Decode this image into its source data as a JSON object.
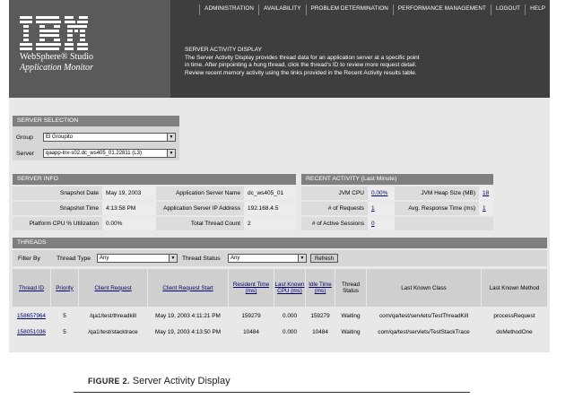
{
  "nav": [
    "ADMINISTRATION",
    "AVAILABILITY",
    "PROBLEM DETERMINATION",
    "PERFORMANCE MANAGEMENT",
    "LOGOUT",
    "HELP"
  ],
  "brand": {
    "logo": "IBM",
    "line1": "WebSphere® Studio",
    "line2": "Application Monitor"
  },
  "intro": {
    "title": "SERVER ACTIVITY DISPLAY",
    "line1": "The Server Activity Display provides thread data for an application server at a specific point",
    "line2": "in time. After pinpointing a hung thread, click the thread's ID to review more request detail.",
    "line3": "Review recent memory activity using the links provided in the Recent Activity results table."
  },
  "server_selection": {
    "title": "SERVER SELECTION",
    "group_label": "Group",
    "group_value": "El Groupito",
    "server_label": "Server",
    "server_value": "qaapp-lnx-s02.dc_ws405_01.22811 (L3)"
  },
  "server_info": {
    "title": "SERVER INFO",
    "snapshot_date_label": "Snapshot Date",
    "snapshot_date": "May 19, 2003",
    "app_server_name_label": "Application Server Name",
    "app_server_name": "dc_ws405_01",
    "snapshot_time_label": "Snapshot Time",
    "snapshot_time": "4:13:58 PM",
    "app_server_ip_label": "Application Server IP Address",
    "app_server_ip": "192.168.4.5",
    "cpu_label": "Platform CPU % Utilization",
    "cpu": "0.00%",
    "thread_count_label": "Total Thread Count",
    "thread_count": "2"
  },
  "recent_activity": {
    "title": "RECENT ACTIVITY (Last Minute)",
    "jvm_cpu_label": "JVM CPU",
    "jvm_cpu": "0.00%",
    "heap_label": "JVM Heap Size (MB)",
    "heap": "18",
    "requests_label": "# of Requests",
    "requests": "1",
    "avg_resp_label": "Avg. Response Time (ms)",
    "avg_resp": "1",
    "sessions_label": "# of Active Sessions",
    "sessions": "0"
  },
  "threads": {
    "title": "THREADS",
    "filter_label": "Filter By",
    "type_label": "Thread Type",
    "type_value": "Any",
    "status_label": "Thread Status",
    "status_value": "Any",
    "refresh": "Refresh",
    "columns": [
      "Thread ID",
      "Priority",
      "Client Request",
      "Client Request Start",
      "Resident Time (ms)",
      "Last Known CPU (ms)",
      "Idle Time (ms)",
      "Thread Status",
      "Last Known Class",
      "Last Known Method"
    ],
    "rows": [
      [
        "158657964",
        "5",
        "/qa1/test/threadkill",
        "May 19, 2003 4:11:21 PM",
        "159279",
        "0.000",
        "159279",
        "Waiting",
        "com/qa/test/servlets/TestThreadKill",
        "processRequest"
      ],
      [
        "158051036",
        "5",
        "/qa1/test/stacktrace",
        "May 19, 2003 4:13:50 PM",
        "10484",
        "0.000",
        "10484",
        "Waiting",
        "com/qa/test/servlets/TestStackTrace",
        "doMethodOne"
      ]
    ]
  },
  "caption": {
    "label": "FIGURE 2.",
    "text": "Server Activity Display"
  }
}
